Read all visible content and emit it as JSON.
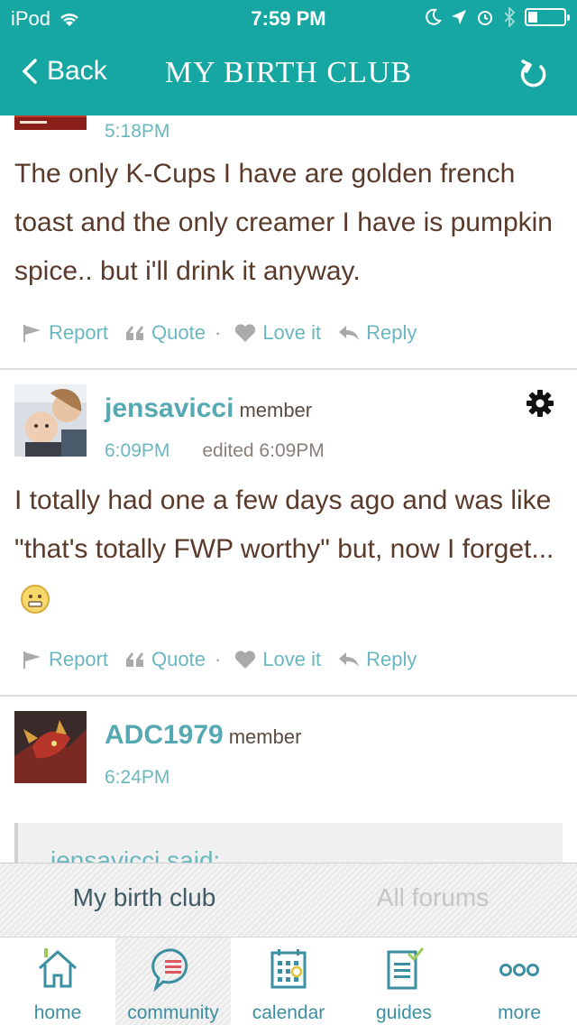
{
  "status_bar": {
    "carrier": "iPod",
    "time": "7:59 PM",
    "battery_level": 0.25
  },
  "nav": {
    "back_label": "Back",
    "title": "MY BIRTH CLUB"
  },
  "posts": [
    {
      "time": "5:18PM",
      "body": "The only K-Cups I have are golden french toast and the only creamer I have is pumpkin spice.. but i'll drink it anyway.",
      "actions": {
        "report": "Report",
        "quote": "Quote",
        "love": "Love it",
        "reply": "Reply"
      }
    },
    {
      "username": "jensavicci",
      "role": "member",
      "time": "6:09PM",
      "edited": "edited 6:09PM",
      "body": "I totally had one a few days ago and was like \"that's totally FWP worthy\" but, now I forget...",
      "actions": {
        "report": "Report",
        "quote": "Quote",
        "love": "Love it",
        "reply": "Reply"
      }
    },
    {
      "username": "ADC1979",
      "role": "member",
      "time": "6:24PM",
      "quote_author": "jensavicci said:"
    }
  ],
  "forum_switcher": {
    "active": "My birth club",
    "inactive": "All forums"
  },
  "tab_bar": {
    "items": [
      {
        "label": "home",
        "icon": "home-icon"
      },
      {
        "label": "community",
        "icon": "speech-bubble-icon",
        "selected": true
      },
      {
        "label": "calendar",
        "icon": "calendar-icon"
      },
      {
        "label": "guides",
        "icon": "clipboard-icon"
      },
      {
        "label": "more",
        "icon": "more-dots-icon"
      }
    ]
  },
  "colors": {
    "header": "#17a7a3",
    "link": "#6ab7bf",
    "text": "#5a3a2a"
  }
}
